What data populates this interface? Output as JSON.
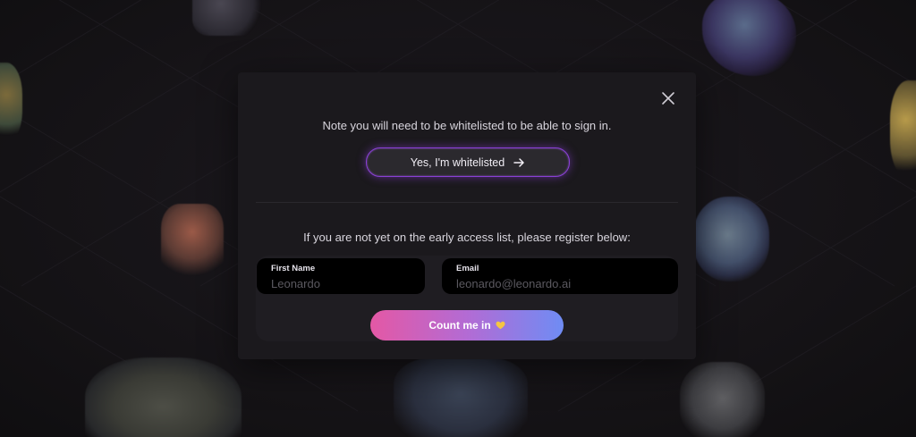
{
  "modal": {
    "note_text": "Note you will need to be whitelisted to be able to sign in.",
    "whitelist_button_label": "Yes, I'm whitelisted",
    "whitelist_button_icon": "arrow-right-icon",
    "register_text": "If you are not yet on the early access list, please register below:",
    "close_icon": "close-icon"
  },
  "form": {
    "first_name": {
      "label": "First Name",
      "placeholder": "Leonardo",
      "value": ""
    },
    "email": {
      "label": "Email",
      "placeholder": "leonardo@leonardo.ai",
      "value": ""
    },
    "submit_label": "Count me in",
    "submit_icon": "yellow-heart-icon"
  },
  "colors": {
    "background": "#161417",
    "modal_background": "#1b191d",
    "whitelist_border": "#8a3fd6",
    "gradient_start": "#e458a5",
    "gradient_end": "#6f8cf4",
    "heart": "#f5c542"
  }
}
